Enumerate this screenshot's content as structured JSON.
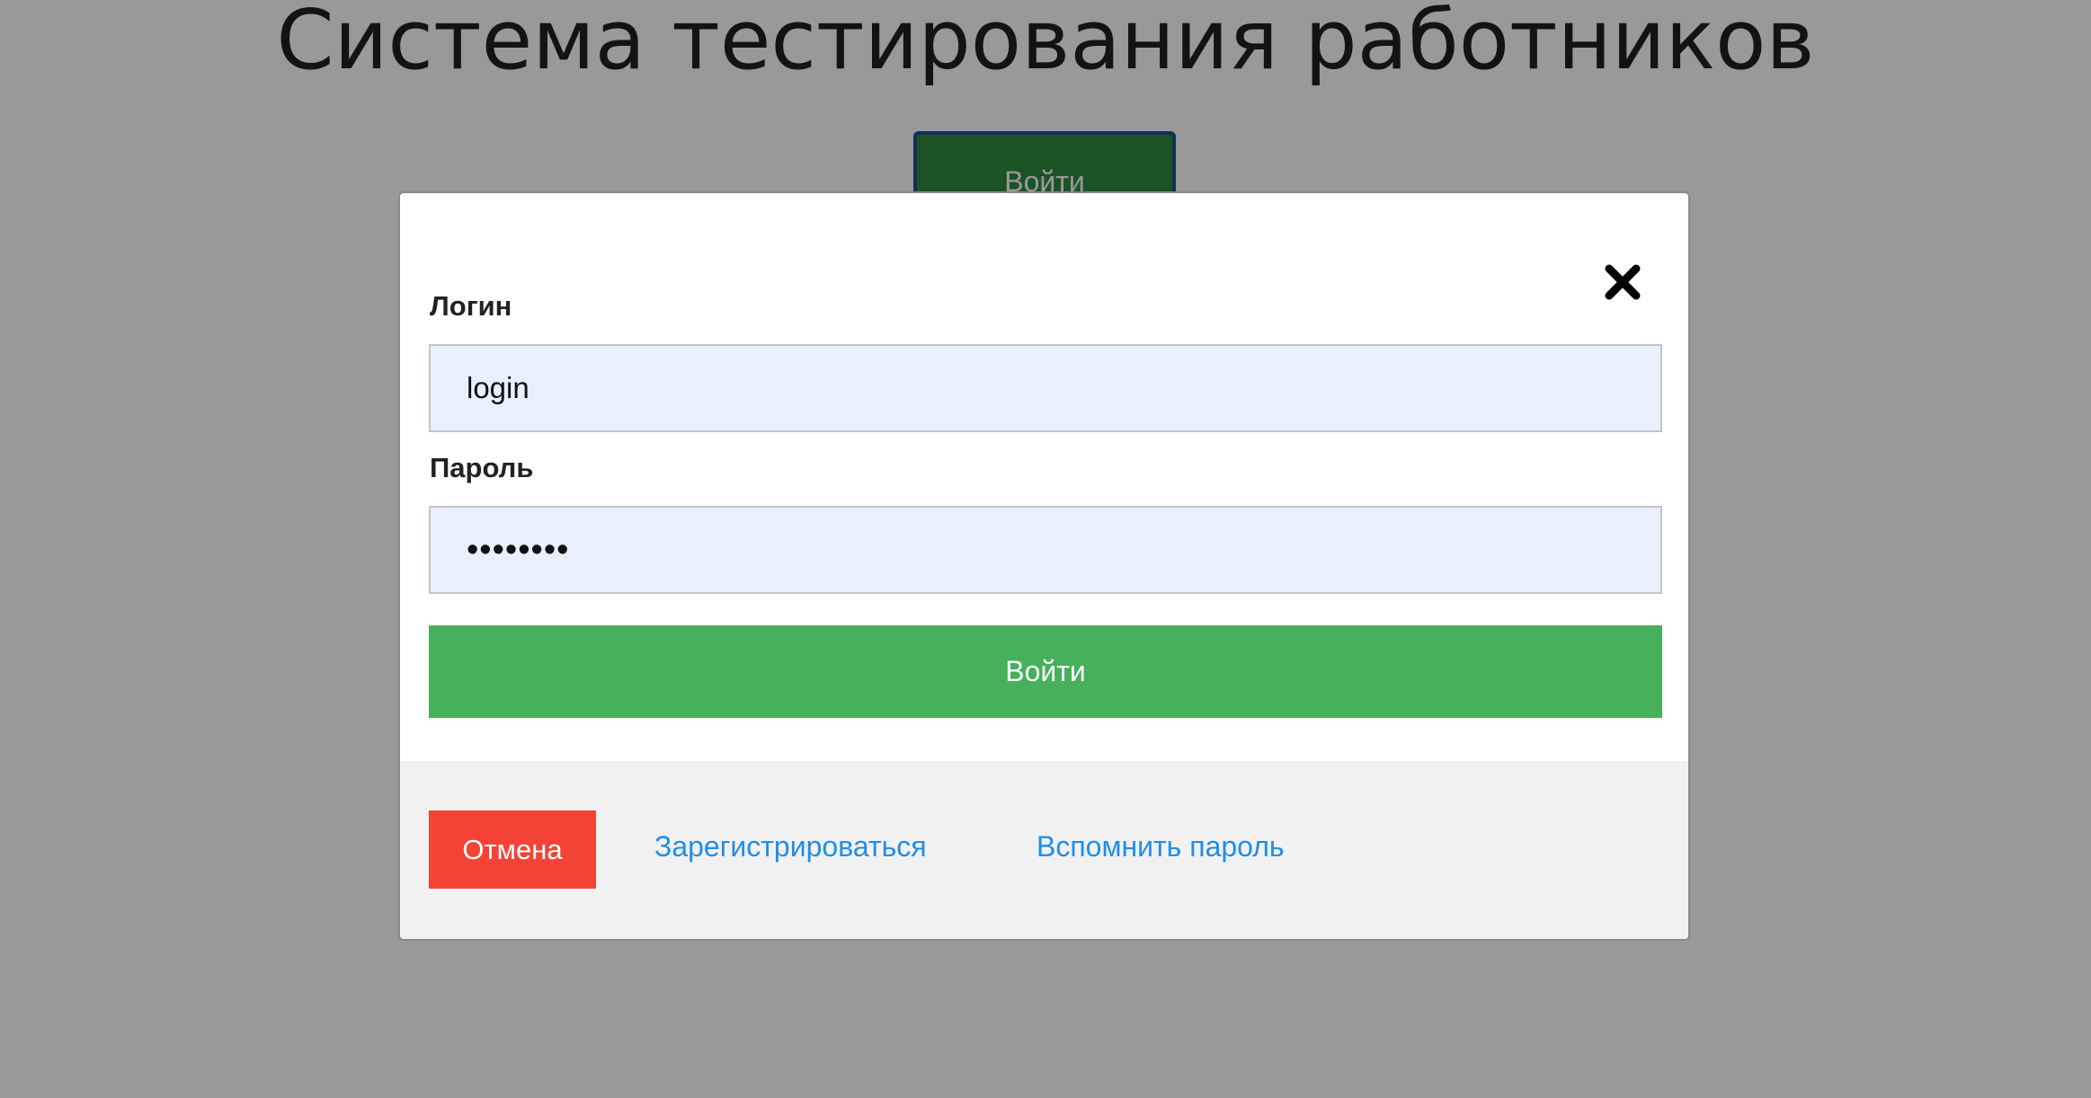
{
  "page": {
    "title": "Система тестирования работников",
    "open_login_label": "Войти"
  },
  "modal": {
    "close_icon": "close-icon",
    "login": {
      "label": "Логин",
      "value": "login"
    },
    "password": {
      "label": "Пароль",
      "value": "••••••••"
    },
    "submit_label": "Войти",
    "footer": {
      "cancel_label": "Отмена",
      "register_label": "Зарегистрироваться",
      "remember_label": "Вспомнить пароль"
    }
  },
  "colors": {
    "overlay": "#999999",
    "submit": "#46b05a",
    "cancel": "#f44336",
    "link": "#1f8ee8",
    "input_background": "#e8f0fe",
    "footer_background": "#f1f1f1"
  }
}
